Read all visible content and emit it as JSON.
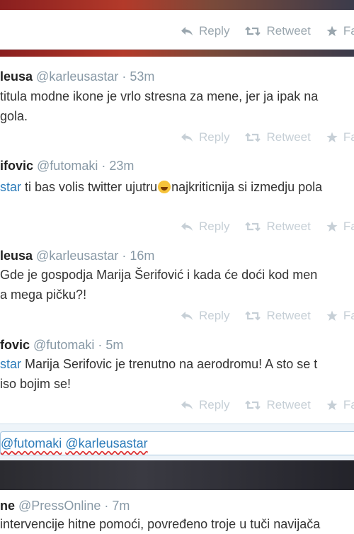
{
  "actions": {
    "reply": "Reply",
    "retweet": "Retweet",
    "favorite": "Fa"
  },
  "tweets": [
    {
      "name": "leusa",
      "handle": "@karleusastar",
      "sep": " · ",
      "time": "53m",
      "lines": [
        "titula modne ikone je vrlo stresna za mene, jer ja ipak na",
        "gola."
      ]
    },
    {
      "name": "ifovic",
      "handle": "@futomaki",
      "sep": " · ",
      "time": "23m",
      "mention": "star",
      "line_a": " ti bas volis twitter ujutru",
      "line_b": "najkriticnija si izmedju pola"
    },
    {
      "name": "leusa",
      "handle": "@karleusastar",
      "sep": " · ",
      "time": "16m",
      "lines": [
        "Gde je gospodja Marija Šerifović i kada će doći kod men",
        "a mega pičku?!"
      ]
    },
    {
      "name": "fovic",
      "handle": "@futomaki",
      "sep": " · ",
      "time": "5m",
      "mention": "star",
      "line_a": " Marija Serifovic je trenutno na aerodromu! A sto se t",
      "line_b": "iso bojim se!"
    }
  ],
  "reply_box": {
    "mention1": "futomaki",
    "mention2": "@karleusastar"
  },
  "press": {
    "name": "ne",
    "handle": "@PressOnline",
    "sep": " · ",
    "time": "7m",
    "line": "intervencije hitne pomoći, povređeno troje u tuči navijača"
  },
  "colors": {
    "link": "#2b7bb9",
    "muted": "#8899a6",
    "action": "#9aa6ae"
  }
}
